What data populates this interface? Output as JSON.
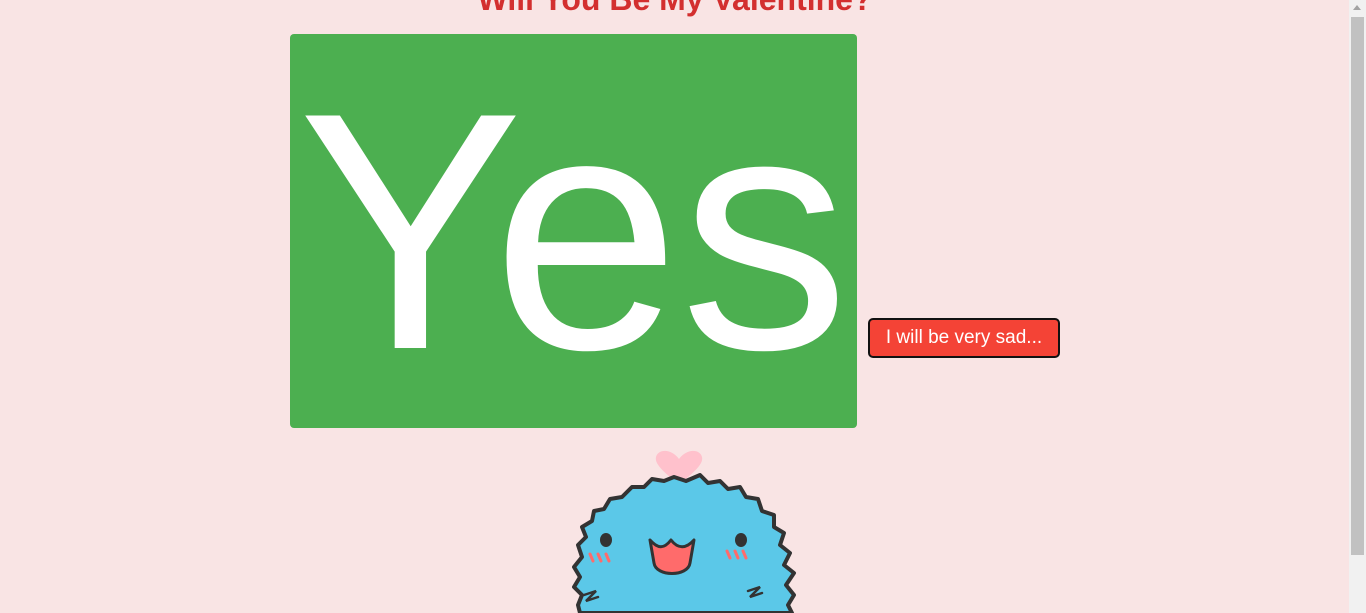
{
  "page": {
    "title": "Will You Be My Valentine?"
  },
  "buttons": {
    "yes_label": "Yes",
    "no_label": "I will be very sad..."
  },
  "mascot": {
    "name": "mascot-illustration"
  },
  "colors": {
    "background": "#f9e4e4",
    "title": "#d32f2f",
    "yes_button": "#4caf50",
    "no_button": "#f44336",
    "mascot_body": "#5bc8e8",
    "heart": "#ffc1cc"
  }
}
